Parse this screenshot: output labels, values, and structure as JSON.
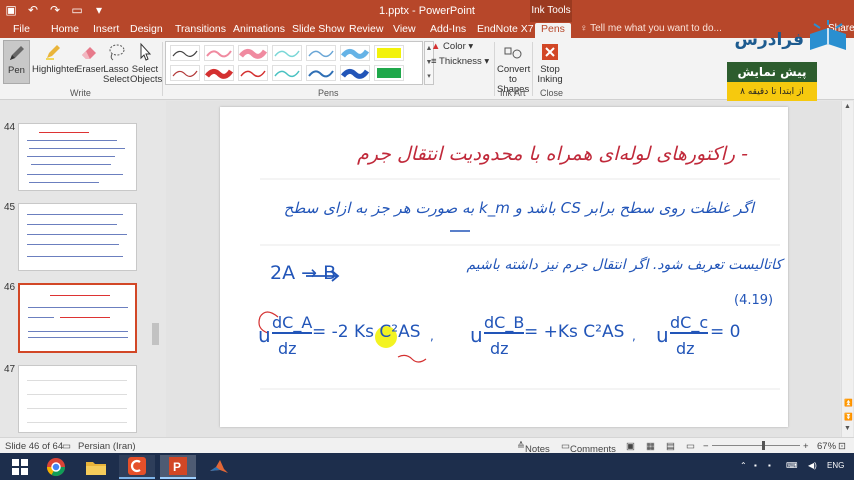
{
  "titlebar": {
    "document_title": "1.pptx - PowerPoint",
    "context_tab_group": "Ink Tools"
  },
  "tabs": [
    {
      "label": "File"
    },
    {
      "label": "Home"
    },
    {
      "label": "Insert"
    },
    {
      "label": "Design"
    },
    {
      "label": "Transitions"
    },
    {
      "label": "Animations"
    },
    {
      "label": "Slide Show"
    },
    {
      "label": "Review"
    },
    {
      "label": "View"
    },
    {
      "label": "Add-Ins"
    },
    {
      "label": "EndNote X7"
    },
    {
      "label": "Pens"
    }
  ],
  "tell_me": "Tell me what you want to do...",
  "share": "Share",
  "ribbon": {
    "write": {
      "pen": "Pen",
      "highlighter": "Highlighter",
      "eraser": "Eraser",
      "lasso_1": "Lasso",
      "lasso_2": "Select",
      "select_1": "Select",
      "select_2": "Objects",
      "group": "Write"
    },
    "pens_group": "Pens",
    "color": "Color",
    "thickness": "Thickness",
    "ink_art": {
      "convert_1": "Convert",
      "convert_2": "to Shapes",
      "group": "Ink Art"
    },
    "close": {
      "stop_1": "Stop",
      "stop_2": "Inking",
      "group": "Close"
    },
    "pen_colors": [
      "#444444",
      "#f08aa0",
      "#7ad7d7",
      "#6aa6d6",
      "#66b3e6",
      "#f2f20a",
      "#b33a3a",
      "#d43030",
      "#49c2c2",
      "#2f6fb5",
      "#2255b8",
      "#1fa84a"
    ]
  },
  "logo": {
    "name": "فرادرس"
  },
  "promo": {
    "line1": "پیش نمایش",
    "line2": "از ابتدا تا دقیقه ۸"
  },
  "thumbnails": [
    {
      "number": "44"
    },
    {
      "number": "45"
    },
    {
      "number": "46"
    },
    {
      "number": "47"
    }
  ],
  "slide": {
    "line1": "- راکتورهای لوله‌ای همراه با محدودیت انتقال جرم",
    "line2": "اگر غلظت روی سطح برابر CS باشد و k_m به صورت هر جز به ازای سطح",
    "line3_right": "کاتالیست تعریف شود. اگر انتقال جرم نیز داشته باشیم",
    "reaction": "2A → B",
    "eq_number": "(4.19)",
    "eq1_lhs_num": "dC_A",
    "eq1_lhs_den": "dz",
    "eq1_rhs": "= -2 Ks C²AS",
    "eq2_lhs_num": "dC_B",
    "eq2_lhs_den": "dz",
    "eq2_rhs": "= +Ks C²AS",
    "eq3_lhs_num": "dC_c",
    "eq3_lhs_den": "dz",
    "eq3_rhs": "= 0",
    "u": "u"
  },
  "statusbar": {
    "slide_info": "Slide 46 of 64",
    "language": "Persian (Iran)",
    "notes": "Notes",
    "comments": "Comments",
    "zoom": "67%"
  },
  "taskbar": {
    "language": "ENG",
    "pinned_apps": [
      "start-icon",
      "chrome-icon",
      "file-explorer-icon",
      "camtasia-icon",
      "powerpoint-icon",
      "matlab-icon"
    ]
  }
}
